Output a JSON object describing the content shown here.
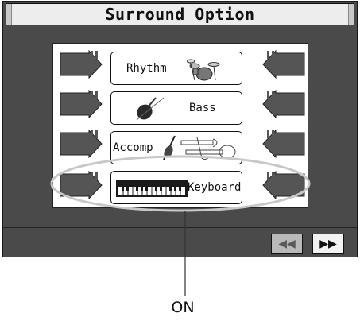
{
  "title": "Surround Option",
  "parts": [
    {
      "label": "Rhythm",
      "icon": "drum-kit-icon"
    },
    {
      "label": "Bass",
      "icon": "double-bass-icon"
    },
    {
      "label": "Accomp",
      "icon": "instruments-icon"
    },
    {
      "label": "Keyboard",
      "icon": "keyboard-icon"
    }
  ],
  "nav": {
    "prev": "◀◀",
    "next": "▶▶"
  },
  "callout": "ON",
  "colors": {
    "screen_bg": "#4a4a4a",
    "panel_bg": "#ffffff",
    "arrow": "#555555"
  }
}
